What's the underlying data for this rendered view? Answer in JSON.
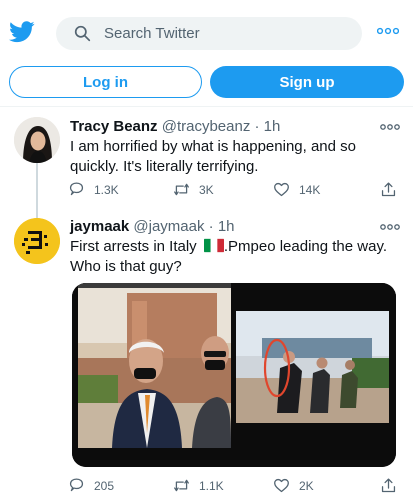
{
  "search": {
    "placeholder": "Search Twitter"
  },
  "auth": {
    "login_label": "Log in",
    "signup_label": "Sign up"
  },
  "tweets": [
    {
      "name": "Tracy Beanz",
      "handle": "@tracybeanz",
      "time": "1h",
      "lines": [
        "I am horrified by what is happening, and so",
        "quickly. It's literally terrifying."
      ],
      "replies": "1.3K",
      "retweets": "3K",
      "likes": "14K"
    },
    {
      "name": "jaymaak",
      "handle": "@jaymaak",
      "time": "1h",
      "line1_before_flag": "First arrests in Italy",
      "line1_after_flag": ".Pmpeo leading the way.",
      "line2": "Who is that guy?",
      "replies": "205",
      "retweets": "1.1K",
      "likes": "2K"
    }
  ],
  "colors": {
    "accent": "#1d9bf0",
    "secondary_text": "#536471",
    "circle_annotation": "#e0462d"
  },
  "icons": {
    "logo": "twitter-bird-icon",
    "search": "search-icon",
    "more": "more-dots-icon",
    "reply": "reply-icon",
    "retweet": "retweet-icon",
    "like": "heart-icon",
    "share": "share-icon"
  }
}
